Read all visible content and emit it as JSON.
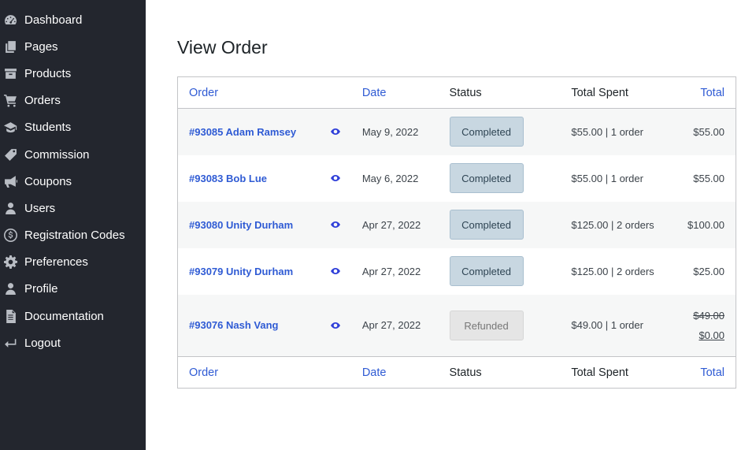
{
  "sidebar": {
    "items": [
      {
        "label": "Dashboard",
        "icon": "dashboard-icon"
      },
      {
        "label": "Pages",
        "icon": "pages-icon"
      },
      {
        "label": "Products",
        "icon": "products-icon"
      },
      {
        "label": "Orders",
        "icon": "cart-icon"
      },
      {
        "label": "Students",
        "icon": "graduation-cap-icon"
      },
      {
        "label": "Commission",
        "icon": "tag-icon"
      },
      {
        "label": "Coupons",
        "icon": "megaphone-icon"
      },
      {
        "label": "Users",
        "icon": "user-icon"
      },
      {
        "label": "Registration Codes",
        "icon": "dollar-circle-icon"
      },
      {
        "label": "Preferences",
        "icon": "gear-icon"
      },
      {
        "label": "Profile",
        "icon": "user-icon"
      },
      {
        "label": "Documentation",
        "icon": "document-icon"
      },
      {
        "label": "Logout",
        "icon": "logout-icon"
      }
    ]
  },
  "page": {
    "title": "View Order"
  },
  "table": {
    "columns": {
      "order": "Order",
      "date": "Date",
      "status": "Status",
      "total_spent": "Total Spent",
      "total": "Total"
    },
    "rows": [
      {
        "order": "#93085 Adam Ramsey",
        "date": "May 9, 2022",
        "status": "Completed",
        "total_spent": "$55.00 | 1 order",
        "total": "$55.00"
      },
      {
        "order": "#93083 Bob Lue",
        "date": "May 6, 2022",
        "status": "Completed",
        "total_spent": "$55.00 | 1 order",
        "total": "$55.00"
      },
      {
        "order": "#93080 Unity Durham",
        "date": "Apr 27, 2022",
        "status": "Completed",
        "total_spent": "$125.00 | 2 orders",
        "total": "$100.00"
      },
      {
        "order": "#93079 Unity Durham",
        "date": "Apr 27, 2022",
        "status": "Completed",
        "total_spent": "$125.00 | 2 orders",
        "total": "$25.00"
      },
      {
        "order": "#93076 Nash Vang",
        "date": "Apr 27, 2022",
        "status": "Refunded",
        "total_spent": "$49.00 | 1 order",
        "total_original": "$49.00",
        "total": "$0.00"
      }
    ]
  },
  "colors": {
    "sidebar_bg": "#23262e",
    "link": "#2f5bd4",
    "completed_bg": "#c8d7e1",
    "refunded_bg": "#e5e5e5"
  }
}
